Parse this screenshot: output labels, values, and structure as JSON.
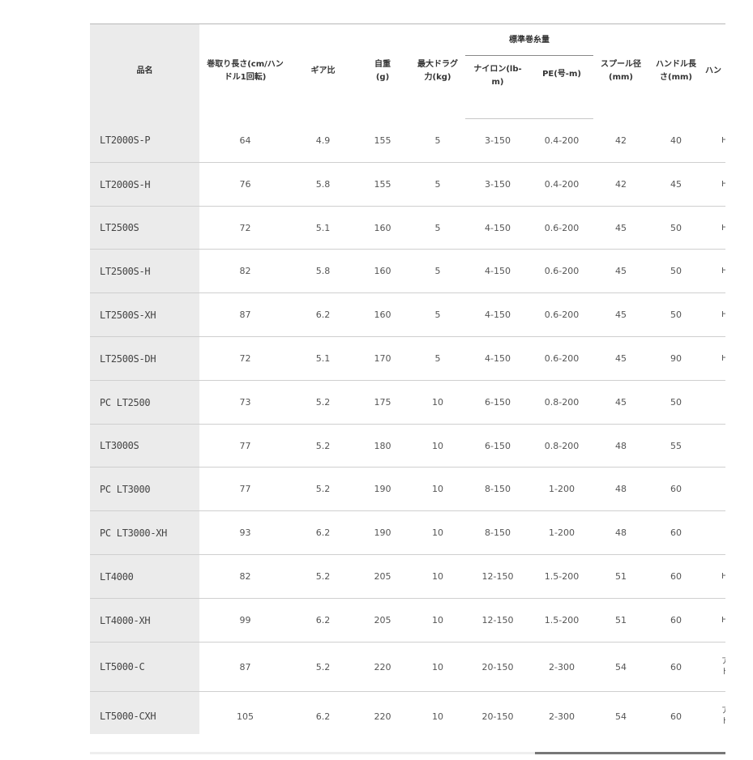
{
  "table": {
    "headers": {
      "name": "品名",
      "retrieve_length": "巻取り長さ(cm/ハンドル1回転)",
      "gear_ratio": "ギア比",
      "weight": "自重(g)",
      "max_drag": "最大ドラグ力(kg)",
      "line_capacity_group": "標準巻糸量",
      "nylon": "ナイロン(lb-m)",
      "pe": "PE(号-m)",
      "spool_diameter": "スプール径(mm)",
      "handle_length": "ハンドル長さ(mm)",
      "knob": "ハン"
    },
    "rows": [
      {
        "name": "LT2000S-P",
        "len": "64",
        "gear": "4.9",
        "wt": "155",
        "drag": "5",
        "ny": "3-150",
        "pe": "0.4-200",
        "sp": "42",
        "hl": "40",
        "knob": "HG"
      },
      {
        "name": "LT2000S-H",
        "len": "76",
        "gear": "5.8",
        "wt": "155",
        "drag": "5",
        "ny": "3-150",
        "pe": "0.4-200",
        "sp": "42",
        "hl": "45",
        "knob": "HG"
      },
      {
        "name": "LT2500S",
        "len": "72",
        "gear": "5.1",
        "wt": "160",
        "drag": "5",
        "ny": "4-150",
        "pe": "0.6-200",
        "sp": "45",
        "hl": "50",
        "knob": "HG"
      },
      {
        "name": "LT2500S-H",
        "len": "82",
        "gear": "5.8",
        "wt": "160",
        "drag": "5",
        "ny": "4-150",
        "pe": "0.6-200",
        "sp": "45",
        "hl": "50",
        "knob": "HG"
      },
      {
        "name": "LT2500S-XH",
        "len": "87",
        "gear": "6.2",
        "wt": "160",
        "drag": "5",
        "ny": "4-150",
        "pe": "0.6-200",
        "sp": "45",
        "hl": "50",
        "knob": "HG"
      },
      {
        "name": "LT2500S-DH",
        "len": "72",
        "gear": "5.1",
        "wt": "170",
        "drag": "5",
        "ny": "4-150",
        "pe": "0.6-200",
        "sp": "45",
        "hl": "90",
        "knob": "HG"
      },
      {
        "name": "PC LT2500",
        "len": "73",
        "gear": "5.2",
        "wt": "175",
        "drag": "10",
        "ny": "6-150",
        "pe": "0.8-200",
        "sp": "45",
        "hl": "50",
        "knob": ""
      },
      {
        "name": "LT3000S",
        "len": "77",
        "gear": "5.2",
        "wt": "180",
        "drag": "10",
        "ny": "6-150",
        "pe": "0.8-200",
        "sp": "48",
        "hl": "55",
        "knob": ""
      },
      {
        "name": "PC LT3000",
        "len": "77",
        "gear": "5.2",
        "wt": "190",
        "drag": "10",
        "ny": "8-150",
        "pe": "1-200",
        "sp": "48",
        "hl": "60",
        "knob": ""
      },
      {
        "name": "PC LT3000-XH",
        "len": "93",
        "gear": "6.2",
        "wt": "190",
        "drag": "10",
        "ny": "8-150",
        "pe": "1-200",
        "sp": "48",
        "hl": "60",
        "knob": ""
      },
      {
        "name": "LT4000",
        "len": "82",
        "gear": "5.2",
        "wt": "205",
        "drag": "10",
        "ny": "12-150",
        "pe": "1.5-200",
        "sp": "51",
        "hl": "60",
        "knob": "HG"
      },
      {
        "name": "LT4000-XH",
        "len": "99",
        "gear": "6.2",
        "wt": "205",
        "drag": "10",
        "ny": "12-150",
        "pe": "1.5-200",
        "sp": "51",
        "hl": "60",
        "knob": "HG"
      },
      {
        "name": "LT5000-C",
        "len": "87",
        "gear": "5.2",
        "wt": "220",
        "drag": "10",
        "ny": "20-150",
        "pe": "2-300",
        "sp": "54",
        "hl": "60",
        "knob": "アル ド"
      },
      {
        "name": "LT5000-CXH",
        "len": "105",
        "gear": "6.2",
        "wt": "220",
        "drag": "10",
        "ny": "20-150",
        "pe": "2-300",
        "sp": "54",
        "hl": "60",
        "knob": "アル ド"
      }
    ]
  },
  "colors": {
    "name_column_bg": "#ebebeb",
    "border": "#cfcfcf",
    "text": "#555555"
  }
}
